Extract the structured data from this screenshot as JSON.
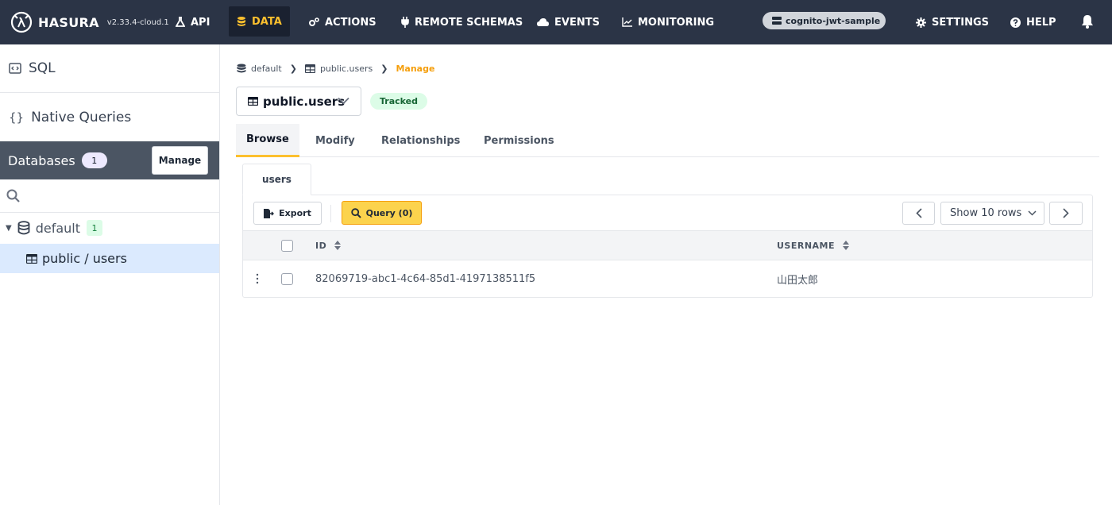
{
  "topnav": {
    "brand": "HASURA",
    "version": "v2.33.4-cloud.1",
    "items": [
      {
        "label": "API",
        "icon": "flask-icon"
      },
      {
        "label": "DATA",
        "icon": "database-icon"
      },
      {
        "label": "ACTIONS",
        "icon": "cogs-icon"
      },
      {
        "label": "REMOTE SCHEMAS",
        "icon": "plug-icon"
      },
      {
        "label": "EVENTS",
        "icon": "cloud-icon"
      },
      {
        "label": "MONITORING",
        "icon": "chart-line-icon"
      }
    ],
    "project": "cognito-jwt-sample",
    "settings": "SETTINGS",
    "help": "HELP",
    "accent": "#fcc02e"
  },
  "sidebar": {
    "sql": "SQL",
    "native_queries": "Native Queries",
    "databases_title": "Databases",
    "databases_count": "1",
    "manage": "Manage",
    "db_name": "default",
    "db_count": "1",
    "table_item": "public / users"
  },
  "main": {
    "breadcrumb": {
      "db": "default",
      "table": "public.users",
      "current": "Manage"
    },
    "table_name": "public.users",
    "tracked": "Tracked",
    "tabs": [
      "Browse",
      "Modify",
      "Relationships",
      "Permissions"
    ],
    "subtab": "users",
    "export": "Export",
    "query": "Query (0)",
    "rows": "Show 10 rows",
    "columns": [
      "ID",
      "USERNAME"
    ],
    "rows_data": [
      {
        "id": "82069719-abc1-4c64-85d1-4197138511f5",
        "username": "山田太郎"
      }
    ]
  }
}
